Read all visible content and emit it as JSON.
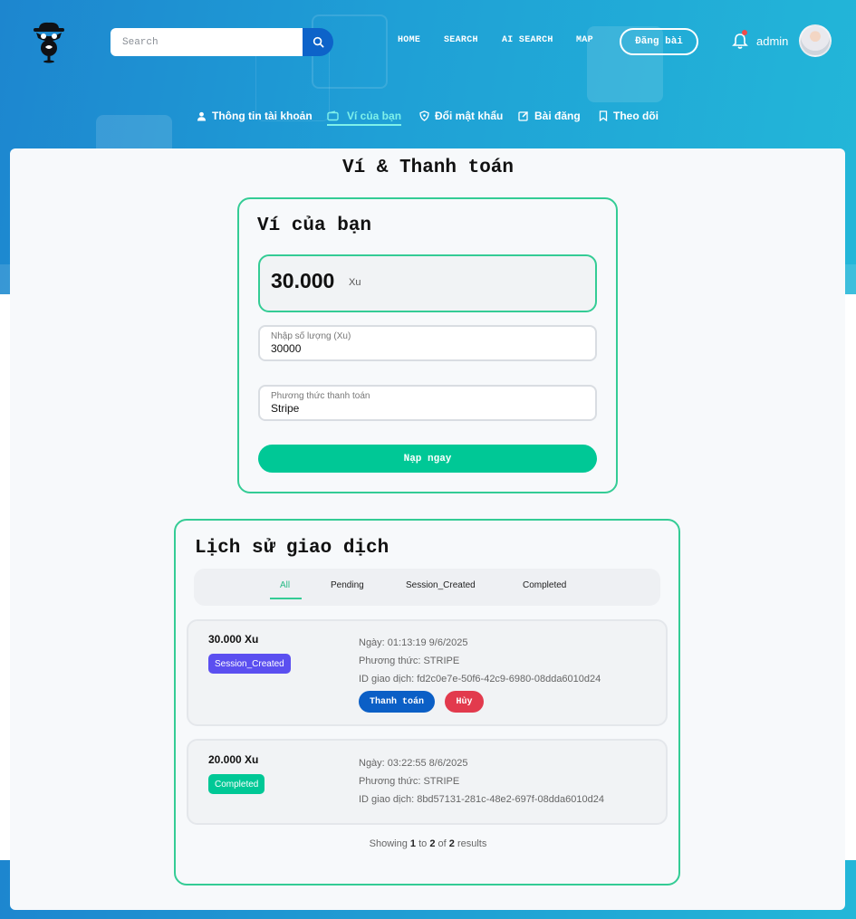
{
  "header": {
    "search_placeholder": "Search",
    "nav": [
      "HOME",
      "SEARCH",
      "AI SEARCH",
      "MAP"
    ],
    "post_button": "Đăng bài",
    "username": "admin",
    "icons": {
      "logo": "spy-pin-logo",
      "search": "search-icon",
      "bell": "bell-icon",
      "avatar": "user-avatar"
    }
  },
  "subnav": [
    {
      "label": "Thông tin tài khoản",
      "icon": "user-icon"
    },
    {
      "label": "Ví của bạn",
      "icon": "wallet-icon",
      "active": true
    },
    {
      "label": "Đổi mật khẩu",
      "icon": "shield-icon"
    },
    {
      "label": "Bài đăng",
      "icon": "edit-icon"
    },
    {
      "label": "Theo dõi",
      "icon": "bookmark-icon"
    }
  ],
  "page": {
    "title": "Ví & Thanh toán"
  },
  "wallet": {
    "title": "Ví của bạn",
    "balance": "30.000",
    "unit": "Xu",
    "amount_field": {
      "label": "Nhập số lượng (Xu)",
      "value": "30000"
    },
    "method_field": {
      "label": "Phương thức thanh toán",
      "value": "Stripe"
    },
    "topup_button": "Nạp ngay"
  },
  "history": {
    "title": "Lịch sử giao dịch",
    "tabs": [
      "All",
      "Pending",
      "Session_Created",
      "Completed"
    ],
    "active_tab": "All",
    "transactions": [
      {
        "amount": "30.000 Xu",
        "status": "Session_Created",
        "status_color": "#5b4ff0",
        "date": "Ngày: 01:13:19 9/6/2025",
        "method": "Phương thức: STRIPE",
        "id": "ID giao dịch: fd2c0e7e-50f6-42c9-6980-08dda6010d24",
        "pay_button": "Thanh toán",
        "cancel_button": "Hủy"
      },
      {
        "amount": "20.000 Xu",
        "status": "Completed",
        "status_color": "#00c896",
        "date": "Ngày: 03:22:55 8/6/2025",
        "method": "Phương thức: STRIPE",
        "id": "ID giao dịch: 8bd57131-281c-48e2-697f-08dda6010d24"
      }
    ],
    "results": {
      "prefix": "Showing",
      "from": "1",
      "to_word": "to",
      "to": "2",
      "of_word": "of",
      "total": "2",
      "suffix": "results"
    }
  },
  "colors": {
    "accent": "#34cc95",
    "primary": "#0d63c9",
    "danger": "#e23a4d",
    "hero": "#1d86cf"
  }
}
